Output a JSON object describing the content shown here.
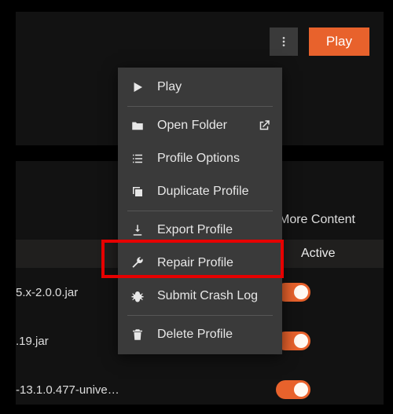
{
  "topbar": {
    "play_label": "Play"
  },
  "tabs": {
    "more_content": "More Content",
    "active_header": "Active"
  },
  "rows": {
    "r0": "5.x-2.0.0.jar",
    "r1": ".19.jar",
    "r2": "-13.1.0.477-unive…"
  },
  "menu": {
    "play": "Play",
    "open_folder": "Open Folder",
    "profile_options": "Profile Options",
    "duplicate_profile": "Duplicate Profile",
    "export_profile": "Export Profile",
    "repair_profile": "Repair Profile",
    "submit_crash": "Submit Crash Log",
    "delete_profile": "Delete Profile"
  }
}
